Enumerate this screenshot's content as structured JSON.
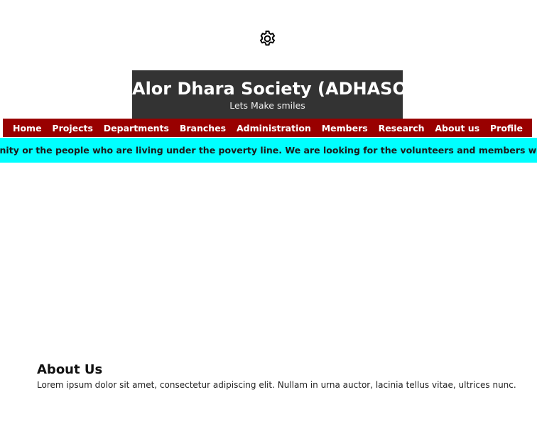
{
  "header": {
    "icon": "gear-icon",
    "brand": {
      "title": "Alor Dhara Society (ADHASO)",
      "tagline": "Lets Make smiles",
      "background": "#333333"
    }
  },
  "nav": {
    "background": "#990000",
    "items": [
      {
        "label": "Home"
      },
      {
        "label": "Projects"
      },
      {
        "label": "Departments"
      },
      {
        "label": "Branches"
      },
      {
        "label": "Administration"
      },
      {
        "label": "Members"
      },
      {
        "label": "Research"
      },
      {
        "label": "About us"
      },
      {
        "label": "Profile"
      }
    ]
  },
  "ticker": {
    "background": "#00ffff",
    "text": "ommunity or the people who are living under the poverty line. We are looking for the volunteers and members who will give t"
  },
  "about": {
    "heading": "About Us",
    "text": "Lorem ipsum dolor sit amet, consectetur adipiscing elit. Nullam in urna auctor, lacinia tellus vitae, ultrices nunc."
  }
}
